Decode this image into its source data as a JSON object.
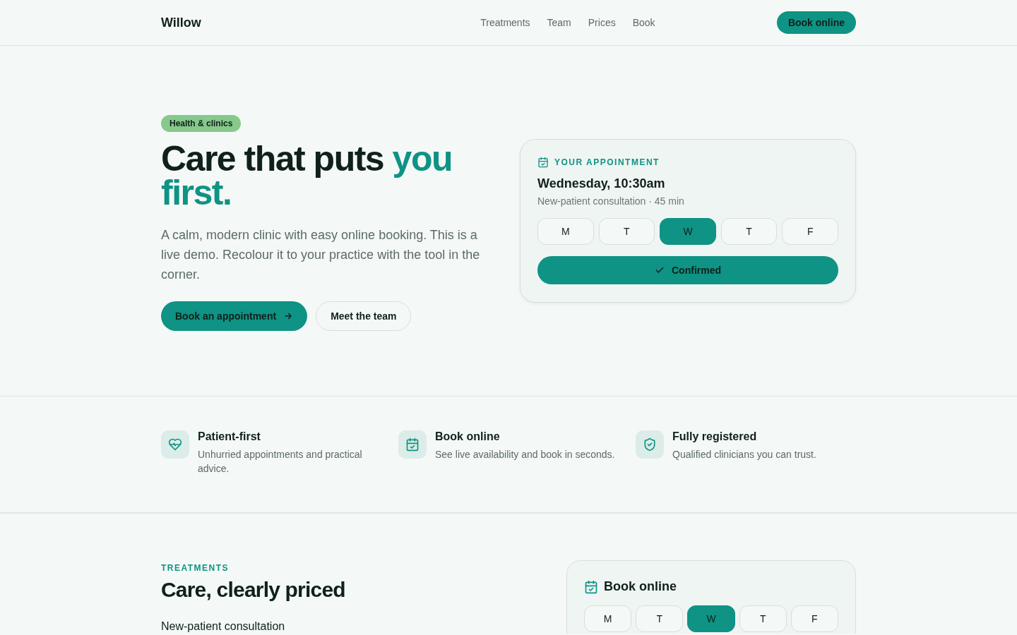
{
  "header": {
    "brand": "Willow",
    "nav": [
      {
        "label": "Treatments"
      },
      {
        "label": "Team"
      },
      {
        "label": "Prices"
      },
      {
        "label": "Book"
      }
    ],
    "cta": "Book online"
  },
  "hero": {
    "badge": "Health & clinics",
    "title_start": "Care that puts",
    "title_accent": "you first.",
    "lead": "A calm, modern clinic with easy online booking. This is a live demo. Recolour it to your practice with the tool in the corner.",
    "primary_button": "Book an appointment",
    "secondary_button": "Meet the team"
  },
  "appointment_card": {
    "eyebrow": "YOUR APPOINTMENT",
    "time": "Wednesday, 10:30am",
    "detail": "New-patient consultation · 45 min",
    "days": [
      {
        "label": "M",
        "selected": false
      },
      {
        "label": "T",
        "selected": false
      },
      {
        "label": "W",
        "selected": true
      },
      {
        "label": "T",
        "selected": false
      },
      {
        "label": "F",
        "selected": false
      }
    ],
    "status": "Confirmed"
  },
  "features": [
    {
      "kind": "heart",
      "title": "Patient-first",
      "text": "Unhurried appointments and practical advice."
    },
    {
      "kind": "calendar",
      "title": "Book online",
      "text": "See live availability and book in seconds."
    },
    {
      "kind": "shield",
      "title": "Fully registered",
      "text": "Qualified clinicians you can trust."
    }
  ],
  "treatments": {
    "eyebrow": "TREATMENTS",
    "title": "Care, clearly priced",
    "first_item": "New-patient consultation"
  },
  "booking_card": {
    "title": "Book online",
    "days": [
      {
        "label": "M",
        "selected": false
      },
      {
        "label": "T",
        "selected": false
      },
      {
        "label": "W",
        "selected": true
      },
      {
        "label": "T",
        "selected": false
      },
      {
        "label": "F",
        "selected": false
      }
    ]
  }
}
